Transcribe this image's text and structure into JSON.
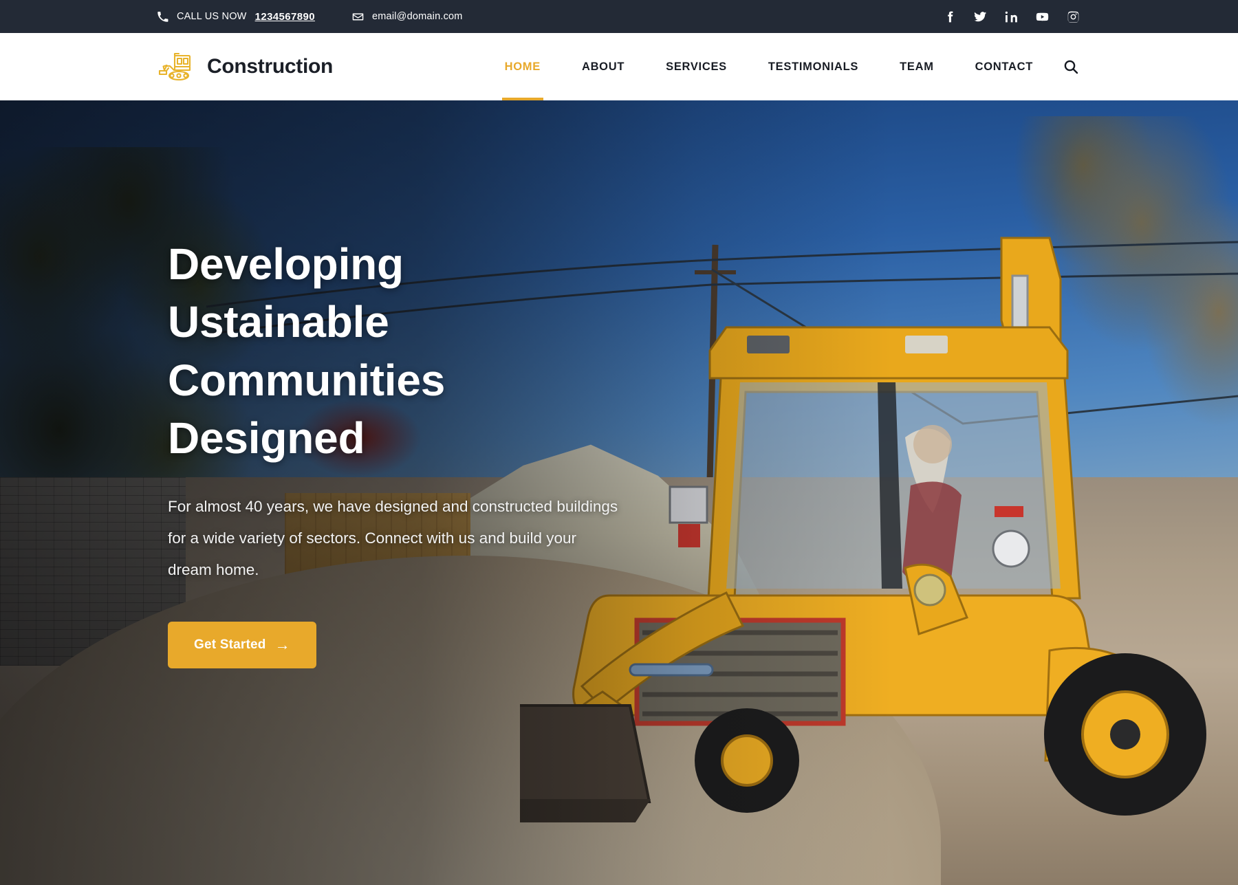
{
  "topbar": {
    "phone_icon": "phone-icon",
    "phone_label": "CALL US NOW",
    "phone_number": "1234567890",
    "email_icon": "envelope-icon",
    "email": "email@domain.com",
    "socials": [
      {
        "name": "facebook-icon",
        "label": "Facebook"
      },
      {
        "name": "twitter-icon",
        "label": "Twitter"
      },
      {
        "name": "linkedin-icon",
        "label": "LinkedIn"
      },
      {
        "name": "youtube-icon",
        "label": "YouTube"
      },
      {
        "name": "instagram-icon",
        "label": "Instagram"
      }
    ],
    "background": "#232A36"
  },
  "header": {
    "logo_text": "Construction",
    "logo_icon": "bulldozer-icon",
    "search_icon": "search-icon",
    "nav": [
      {
        "label": "HOME",
        "active": true
      },
      {
        "label": "ABOUT",
        "active": false
      },
      {
        "label": "SERVICES",
        "active": false
      },
      {
        "label": "TESTIMONIALS",
        "active": false
      },
      {
        "label": "TEAM",
        "active": false
      },
      {
        "label": "CONTACT",
        "active": false
      }
    ],
    "accent_color": "#E8A92B",
    "text_color": "#181c24"
  },
  "hero": {
    "title_line1": "Developing",
    "title_line2": "Ustainable",
    "title_line3": "Communities",
    "title_line4": "Designed",
    "subtitle": "For almost 40 years, we have designed and constructed buildings for a wide variety of sectors. Connect with us and build your dream home.",
    "cta_label": "Get Started",
    "cta_arrow": "→",
    "cta_color": "#E8A92B",
    "background_image": "construction-site-backhoe-loader-photo"
  }
}
